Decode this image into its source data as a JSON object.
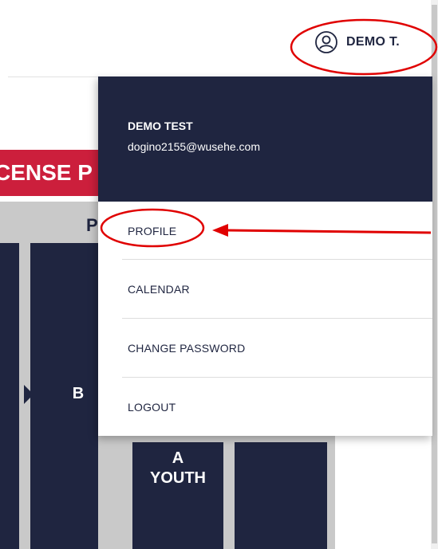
{
  "user_menu": {
    "display_name": "DEMO T.",
    "icon": "user-circle-icon"
  },
  "background": {
    "license_header": "CENSE P",
    "band_letter": "P",
    "col_b_label": "B",
    "col_youth_label": "A\nYOUTH"
  },
  "dropdown": {
    "header": {
      "name": "DEMO TEST",
      "email": "dogino2155@wusehe.com"
    },
    "items": [
      {
        "label": "PROFILE"
      },
      {
        "label": "CALENDAR"
      },
      {
        "label": "CHANGE PASSWORD"
      },
      {
        "label": "LOGOUT"
      }
    ]
  },
  "colors": {
    "navy": "#1f2540",
    "red_banner": "#cc1f3c",
    "annotation_red": "#e00000"
  }
}
